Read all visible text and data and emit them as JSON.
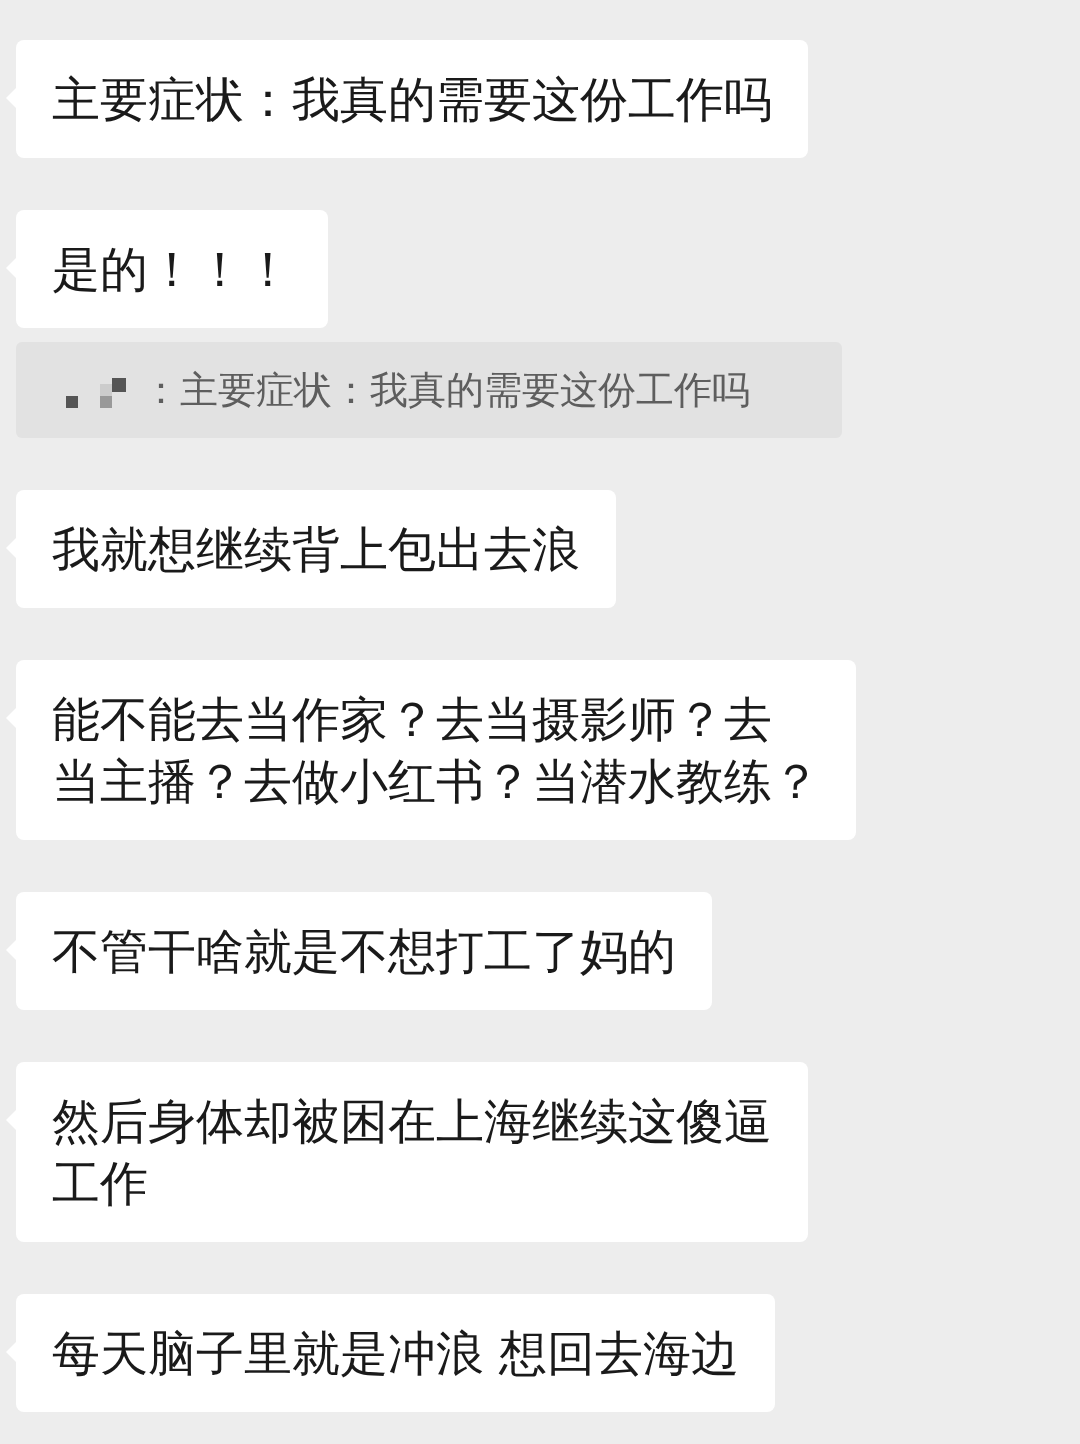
{
  "messages": [
    {
      "lines": [
        "主要症状：我真的需要这份工作吗"
      ]
    },
    {
      "lines": [
        "是的！！！"
      ],
      "quote": {
        "text": "：主要症状：我真的需要这份工作吗"
      }
    },
    {
      "lines": [
        "我就想继续背上包出去浪"
      ]
    },
    {
      "lines": [
        "能不能去当作家？去当摄影师？去",
        "当主播？去做小红书？当潜水教练？"
      ]
    },
    {
      "lines": [
        "不管干啥就是不想打工了妈的"
      ]
    },
    {
      "lines": [
        "然后身体却被困在上海继续这傻逼",
        "工作"
      ]
    },
    {
      "lines": [
        "每天脑子里就是冲浪 想回去海边"
      ]
    }
  ]
}
